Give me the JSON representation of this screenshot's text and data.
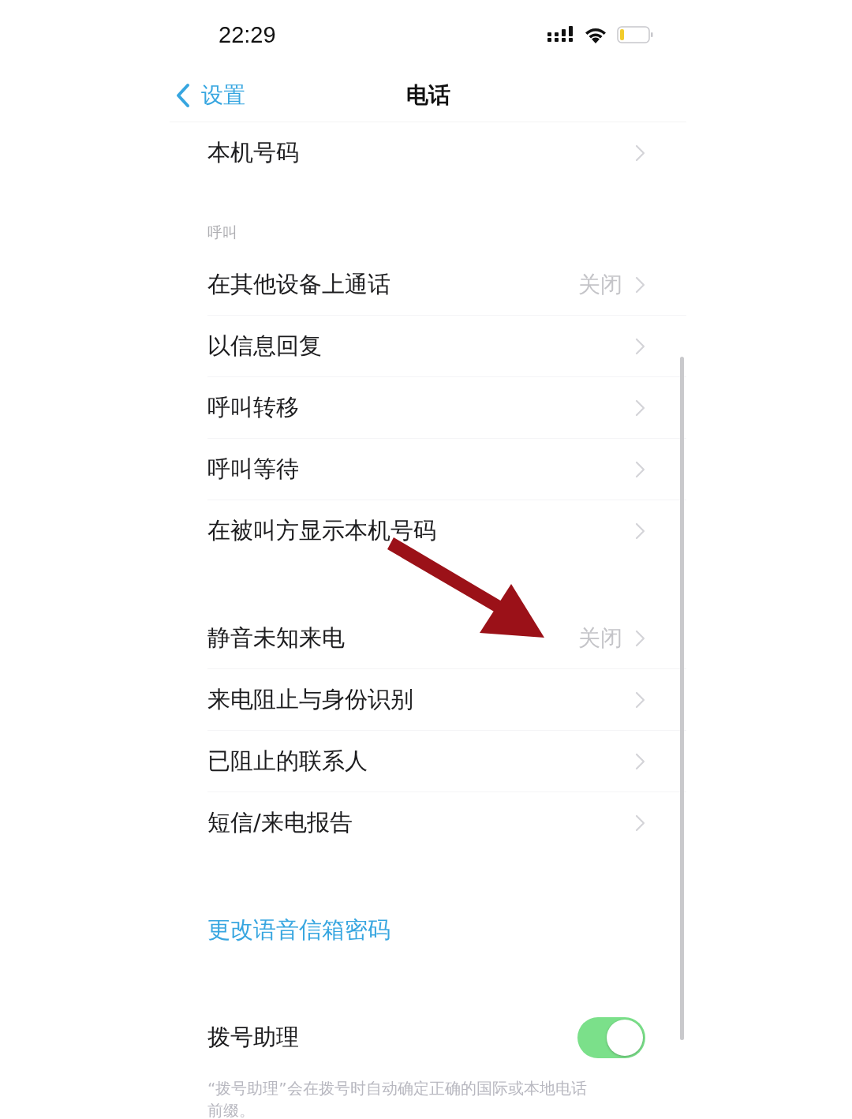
{
  "status_bar": {
    "time": "22:29"
  },
  "nav": {
    "back_label": "设置",
    "title": "电话"
  },
  "groups": [
    {
      "rows": [
        {
          "kind": "disclosure",
          "label": "本机号码"
        }
      ]
    },
    {
      "header": "呼叫",
      "rows": [
        {
          "kind": "disclosure",
          "label": "在其他设备上通话",
          "value": "关闭"
        },
        {
          "kind": "disclosure",
          "label": "以信息回复"
        },
        {
          "kind": "disclosure",
          "label": "呼叫转移"
        },
        {
          "kind": "disclosure",
          "label": "呼叫等待"
        },
        {
          "kind": "disclosure",
          "label": "在被叫方显示本机号码"
        }
      ]
    },
    {
      "rows": [
        {
          "kind": "disclosure",
          "label": "静音未知来电",
          "value": "关闭"
        },
        {
          "kind": "disclosure",
          "label": "来电阻止与身份识别"
        },
        {
          "kind": "disclosure",
          "label": "已阻止的联系人"
        },
        {
          "kind": "disclosure",
          "label": "短信/来电报告"
        }
      ]
    },
    {
      "rows": [
        {
          "kind": "link",
          "label": "更改语音信箱密码"
        }
      ]
    },
    {
      "rows": [
        {
          "kind": "toggle",
          "label": "拨号助理",
          "on": true
        }
      ],
      "footer": "“拨号助理”会在拨号时自动确定正确的国际或本地电话前缀。"
    }
  ],
  "annotations": [
    {
      "kind": "arrow"
    }
  ]
}
